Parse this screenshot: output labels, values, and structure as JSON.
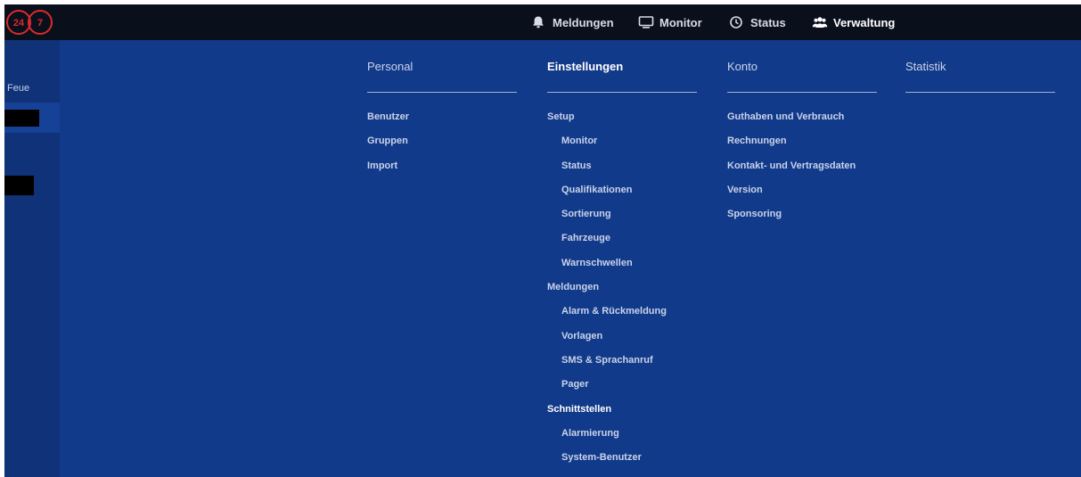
{
  "brand": {
    "logo_text_left": "24",
    "logo_text_right": "7",
    "logo_color": "#d92b2b"
  },
  "topnav": {
    "items": [
      {
        "label": "Meldungen",
        "icon": "bell-icon"
      },
      {
        "label": "Monitor",
        "icon": "monitor-icon"
      },
      {
        "label": "Status",
        "icon": "clock-icon"
      },
      {
        "label": "Verwaltung",
        "icon": "users-icon",
        "active": true
      }
    ]
  },
  "sidebar": {
    "label": "Feue"
  },
  "menu": {
    "columns": [
      {
        "title": "Personal",
        "items": [
          {
            "label": "Benutzer"
          },
          {
            "label": "Gruppen"
          },
          {
            "label": "Import"
          }
        ]
      },
      {
        "title": "Einstellungen",
        "active": true,
        "items": [
          {
            "label": "Setup"
          },
          {
            "label": "Monitor",
            "sub": true
          },
          {
            "label": "Status",
            "sub": true
          },
          {
            "label": "Qualifikationen",
            "sub": true
          },
          {
            "label": "Sortierung",
            "sub": true
          },
          {
            "label": "Fahrzeuge",
            "sub": true
          },
          {
            "label": "Warnschwellen",
            "sub": true
          },
          {
            "label": "Meldungen"
          },
          {
            "label": "Alarm & Rückmeldung",
            "sub": true
          },
          {
            "label": "Vorlagen",
            "sub": true
          },
          {
            "label": "SMS & Sprachanruf",
            "sub": true
          },
          {
            "label": "Pager",
            "sub": true
          },
          {
            "label": "Schnittstellen",
            "active": true
          },
          {
            "label": "Alarmierung",
            "sub": true
          },
          {
            "label": "System-Benutzer",
            "sub": true
          }
        ]
      },
      {
        "title": "Konto",
        "items": [
          {
            "label": "Guthaben und Verbrauch"
          },
          {
            "label": "Rechnungen"
          },
          {
            "label": "Kontakt- und Vertragsdaten"
          },
          {
            "label": "Version"
          },
          {
            "label": "Sponsoring"
          }
        ]
      },
      {
        "title": "Statistik",
        "items": []
      }
    ]
  }
}
